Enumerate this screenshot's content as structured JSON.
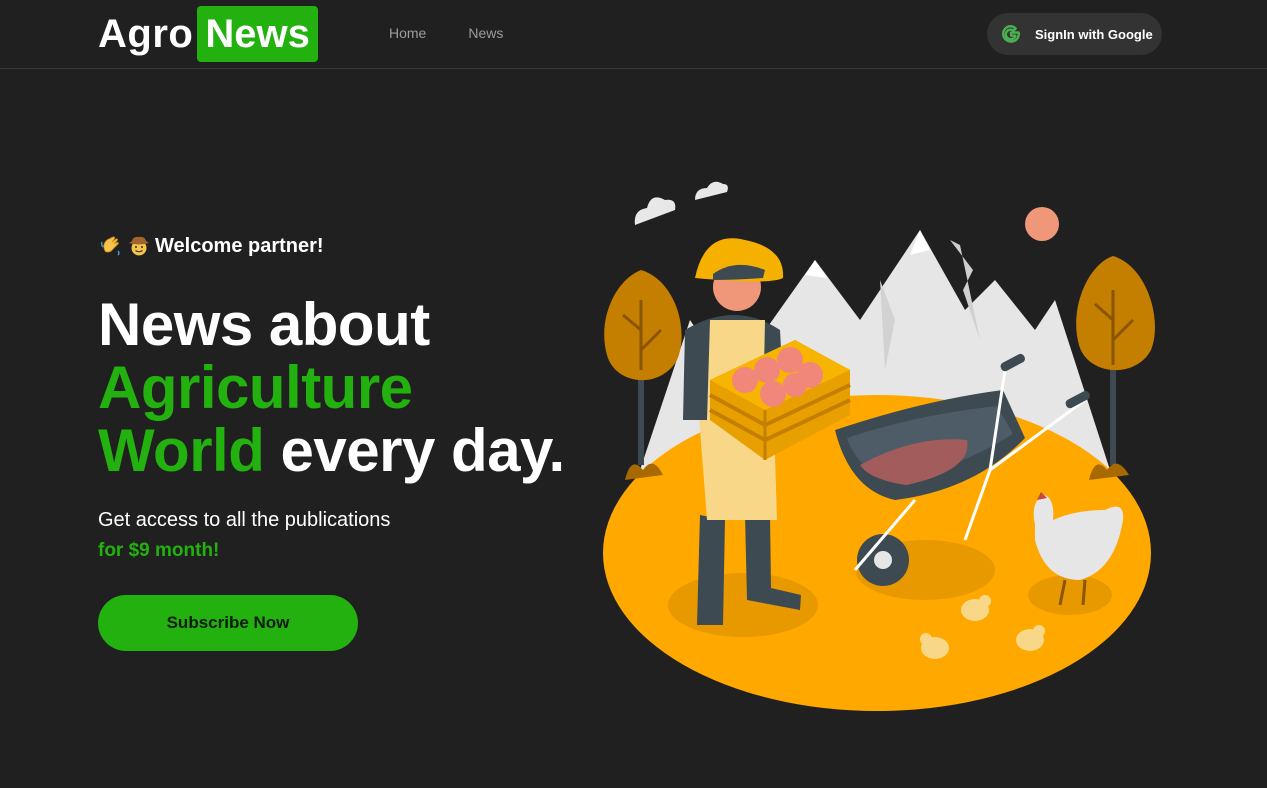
{
  "header": {
    "logo": {
      "part1": "Agro",
      "part2": "News"
    },
    "nav": [
      {
        "label": "Home"
      },
      {
        "label": "News"
      }
    ],
    "signin_label": "SignIn with Google"
  },
  "hero": {
    "greeting_icons": [
      "waving-hand-icon",
      "cowboy-face-icon"
    ],
    "greeting": "Welcome partner!",
    "headline": {
      "line1": "News about",
      "line2": "Agriculture",
      "line3_green": "World",
      "line3_rest": " every day."
    },
    "subtitle": "Get access to all the publications",
    "price": "for $9 month!",
    "cta_label": "Subscribe Now"
  },
  "colors": {
    "background": "#202020",
    "accent": "#22b10e",
    "field": "#ffa800",
    "tree": "#c47e00"
  }
}
